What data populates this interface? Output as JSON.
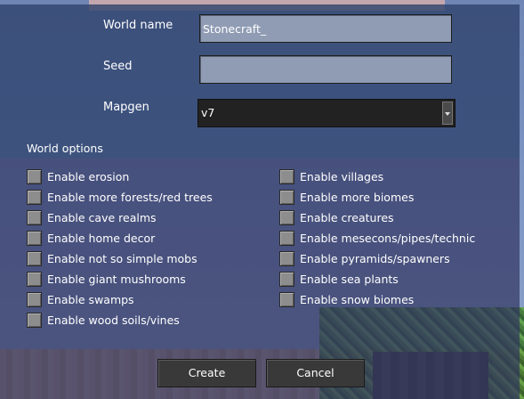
{
  "form": {
    "world_name_label": "World name",
    "world_name_value": "Stonecraft_",
    "seed_label": "Seed",
    "seed_value": "",
    "mapgen_label": "Mapgen",
    "mapgen_value": "v7",
    "options_title": "World options"
  },
  "options_left": [
    {
      "label": "Enable erosion",
      "checked": false
    },
    {
      "label": "Enable more forests/red trees",
      "checked": false
    },
    {
      "label": "Enable cave realms",
      "checked": false
    },
    {
      "label": "Enable home decor",
      "checked": false
    },
    {
      "label": "Enable not so simple mobs",
      "checked": false
    },
    {
      "label": "Enable giant mushrooms",
      "checked": false
    },
    {
      "label": "Enable swamps",
      "checked": false
    },
    {
      "label": "Enable wood soils/vines",
      "checked": false
    }
  ],
  "options_right": [
    {
      "label": "Enable villages",
      "checked": false
    },
    {
      "label": "Enable more biomes",
      "checked": false
    },
    {
      "label": "Enable creatures",
      "checked": false
    },
    {
      "label": "Enable mesecons/pipes/technic",
      "checked": false
    },
    {
      "label": "Enable pyramids/spawners",
      "checked": false
    },
    {
      "label": "Enable sea plants",
      "checked": false
    },
    {
      "label": "Enable snow biomes",
      "checked": false
    }
  ],
  "buttons": {
    "create_label": "Create",
    "cancel_label": "Cancel"
  },
  "icons": {
    "dropdown": "chevron-down-icon",
    "checkbox": "checkbox-unchecked-icon"
  }
}
